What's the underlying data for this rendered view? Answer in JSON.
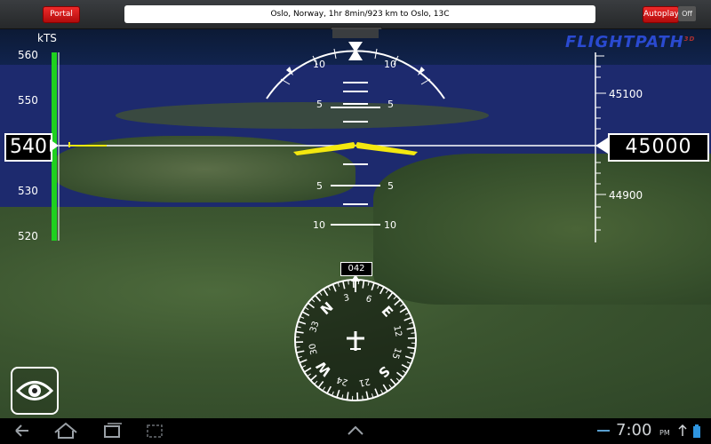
{
  "topbar": {
    "portal_label": "Portal",
    "route_text": "Oslo, Norway, 1hr 8min/923 km to Oslo, 13C",
    "autoplay_label": "Autoplay",
    "autoplay_state": "Off"
  },
  "brand": {
    "name": "FLIGHTPATH",
    "sup": "3D"
  },
  "speed": {
    "unit": "kTS",
    "current": "540",
    "ticks": [
      "560",
      "550",
      "530",
      "520"
    ]
  },
  "altitude": {
    "current": "45000",
    "ticks": [
      "45100",
      "44900"
    ]
  },
  "pitch_labels": [
    "10",
    "10",
    "5",
    "5",
    "5",
    "5",
    "10",
    "10"
  ],
  "heading": {
    "current": "042",
    "compass_labels": [
      "N",
      "3",
      "6",
      "E",
      "12",
      "15",
      "S",
      "21",
      "24",
      "W",
      "30",
      "33"
    ]
  },
  "statusbar": {
    "time": "7:00",
    "ampm": "PM"
  },
  "colors": {
    "speed_bar": "#1fd11f",
    "aircraft_symbol": "#f4e80f",
    "button_red": "#d81818"
  },
  "icons": [
    "eye-icon",
    "back-icon",
    "home-icon",
    "recent-apps-icon",
    "screenshot-icon",
    "up-chevron-icon",
    "usb-icon",
    "battery-icon"
  ]
}
